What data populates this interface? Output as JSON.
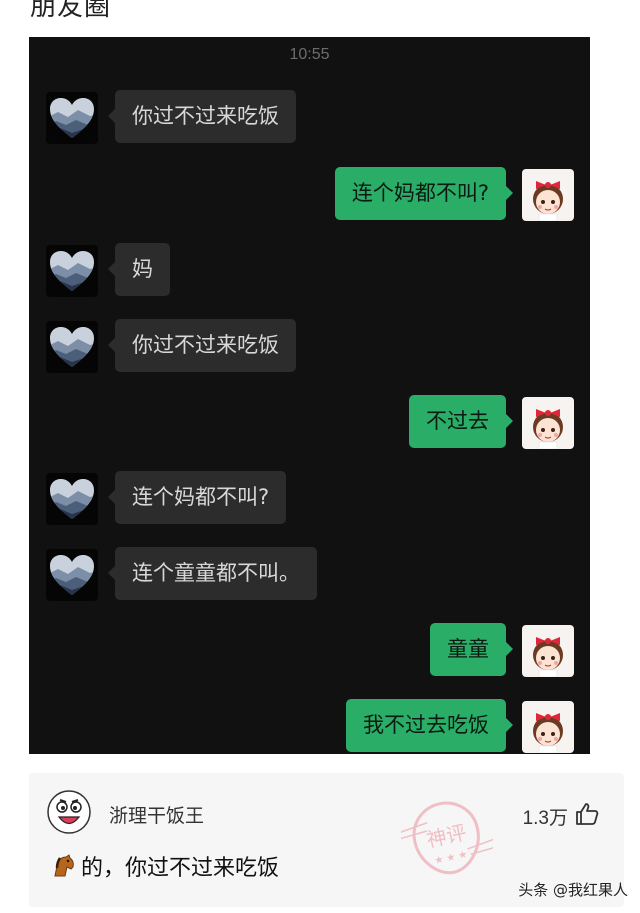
{
  "page_title": "朋友圈",
  "chat": {
    "time": "10:55",
    "messages": [
      {
        "side": "left",
        "text": "你过不过来吃饭"
      },
      {
        "side": "right",
        "text": "连个妈都不叫?"
      },
      {
        "side": "left",
        "text": "妈"
      },
      {
        "side": "left",
        "text": "你过不过来吃饭"
      },
      {
        "side": "right",
        "text": "不过去"
      },
      {
        "side": "left",
        "text": "连个妈都不叫?"
      },
      {
        "side": "left",
        "text": "连个童童都不叫。"
      },
      {
        "side": "right",
        "text": "童童"
      },
      {
        "side": "right",
        "text": "我不过去吃饭"
      }
    ]
  },
  "comment": {
    "username": "浙理干饭王",
    "likes": "1.3万",
    "text": "的，你过不过来吃饭",
    "emoji_icon": "horse-emoji",
    "stamp_text": "神评"
  },
  "watermark": "头条 @我红果人",
  "colors": {
    "chat_bg": "#111111",
    "left_bubble": "#2c2c2c",
    "right_bubble": "#2aae67",
    "card_bg": "#f6f6f6"
  }
}
